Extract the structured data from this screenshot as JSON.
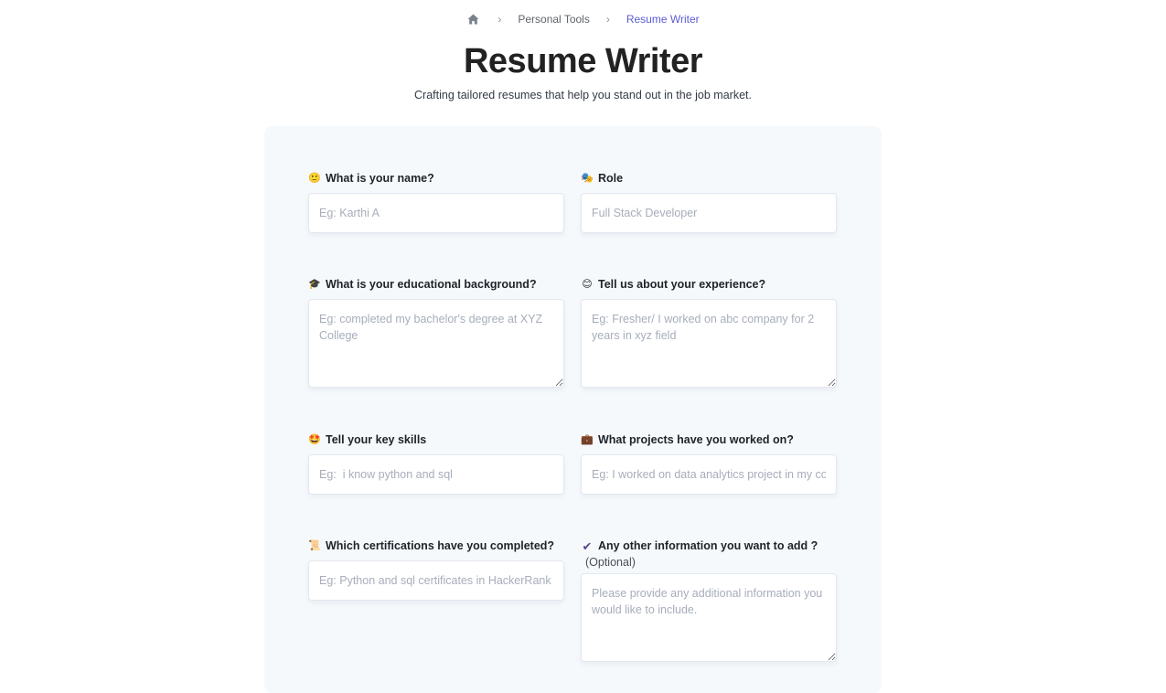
{
  "breadcrumb": {
    "home_icon": "home-icon",
    "separator": "›",
    "items": [
      {
        "label": "Personal Tools"
      },
      {
        "label": "Resume Writer"
      }
    ],
    "current_color": "#5b5bd6"
  },
  "header": {
    "title": "Resume Writer",
    "subtitle": "Crafting tailored resumes that help you stand out in the job market."
  },
  "form": {
    "fields": [
      {
        "icon": "slightly-smiling-face-icon",
        "emoji": "🙂",
        "label": "What is your name?",
        "type": "input",
        "placeholder": "Eg: Karthi A",
        "value": ""
      },
      {
        "icon": "performing-arts-icon",
        "emoji": "🎭",
        "label": "Role",
        "type": "input",
        "placeholder": "Full Stack Developer",
        "value": ""
      },
      {
        "icon": "graduation-cap-icon",
        "emoji": "🎓",
        "label": "What is your educational background?",
        "type": "textarea",
        "placeholder": "Eg: completed my bachelor's degree at XYZ College",
        "value": ""
      },
      {
        "icon": "smiling-face-icon",
        "emoji": "😊",
        "label": "Tell us about your experience?",
        "type": "textarea",
        "placeholder": "Eg: Fresher/ I worked on abc company for 2 years in xyz field",
        "value": ""
      },
      {
        "icon": "star-struck-icon",
        "emoji": "🤩",
        "label": "Tell your key skills",
        "type": "input",
        "placeholder": "Eg:  i know python and sql",
        "value": ""
      },
      {
        "icon": "briefcase-icon",
        "emoji": "💼",
        "label": "What projects have you worked on?",
        "type": "input",
        "placeholder": "Eg: I worked on data analytics project in my college",
        "value": ""
      },
      {
        "icon": "scroll-icon",
        "emoji": "📜",
        "label": "Which certifications have you completed?",
        "type": "input",
        "placeholder": "Eg: Python and sql certificates in HackerRank",
        "value": ""
      },
      {
        "icon": "check-mark-icon",
        "emoji": "✔",
        "label": "Any other information you want to add ?",
        "optional": "(Optional)",
        "type": "textarea",
        "placeholder": "Please provide any additional information you would like to include.",
        "value": ""
      }
    ]
  }
}
